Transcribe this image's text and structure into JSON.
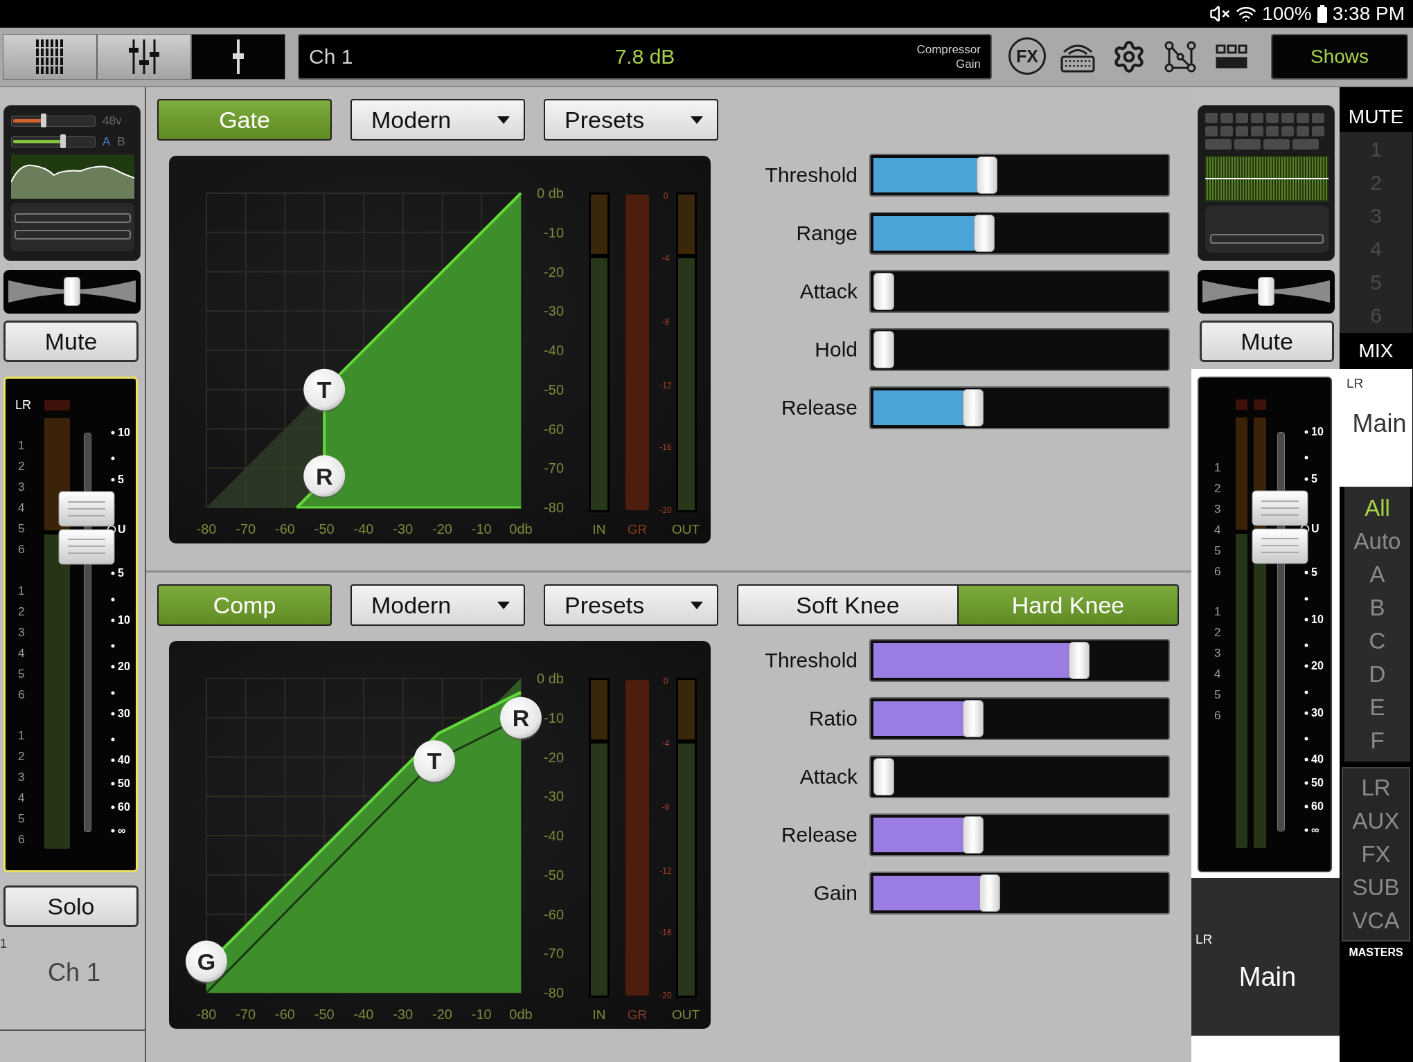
{
  "status_bar": {
    "battery": "100%",
    "time": "3:38 PM"
  },
  "toolbar": {
    "view_tabs": [
      {
        "kind": "bank",
        "selected": false
      },
      {
        "kind": "mixer",
        "selected": false
      },
      {
        "kind": "fader",
        "selected": true
      }
    ],
    "channel_display": {
      "channel": "Ch 1",
      "value": "7.8 dB",
      "parameter": [
        "Compressor",
        "Gain"
      ]
    },
    "tools": [
      {
        "kind": "fx",
        "label": "FX"
      },
      {
        "kind": "keyboard"
      },
      {
        "kind": "settings"
      },
      {
        "kind": "routing"
      },
      {
        "kind": "layout"
      }
    ],
    "shows_button": "Shows"
  },
  "channel_strip": {
    "gain_sliders": [
      {
        "color": "#d2602e",
        "level": 0.38
      },
      {
        "color": "#86c23c",
        "level": 0.62
      }
    ],
    "phantom": "48v",
    "inputs": [
      {
        "label": "A",
        "selected": true
      },
      {
        "label": "B",
        "selected": false
      }
    ],
    "pan": {
      "level": 0.5
    },
    "mute": {
      "label": "Mute",
      "on": false
    },
    "selected": true,
    "kind": "mono",
    "bus": "LR",
    "meter_groups": [
      [
        "1",
        "2",
        "3",
        "4",
        "5",
        "6"
      ],
      [
        "1",
        "2",
        "3",
        "4",
        "5",
        "6"
      ],
      [
        "1",
        "2",
        "3",
        "4",
        "5",
        "6"
      ]
    ],
    "scale": [
      {
        "label": "10",
        "kind": "tick"
      },
      {
        "label": "5",
        "kind": "tick"
      },
      {
        "label": "U",
        "kind": "unity"
      },
      {
        "label": "5",
        "kind": "tick"
      },
      {
        "label": "10",
        "kind": "tick"
      },
      {
        "label": "20",
        "kind": "tick"
      },
      {
        "label": "30",
        "kind": "tick"
      },
      {
        "label": "40",
        "kind": "tick"
      },
      {
        "label": "50",
        "kind": "tick"
      },
      {
        "label": "60",
        "kind": "tick"
      },
      {
        "label": "∞",
        "kind": "tick"
      }
    ],
    "fader": {
      "level": 0.76
    },
    "solo": {
      "label": "Solo",
      "on": false
    },
    "number": "1",
    "name": "Ch 1"
  },
  "gate": {
    "kind": "gate",
    "enabled": {
      "label": "Gate",
      "on": true
    },
    "mode": "Modern",
    "presets": "Presets",
    "graph": {
      "y_ticks": [
        "0 db",
        "-10",
        "-20",
        "-30",
        "-40",
        "-50",
        "-60",
        "-70",
        "-80"
      ],
      "x_ticks": [
        "-80",
        "-70",
        "-60",
        "-50",
        "-40",
        "-30",
        "-20",
        "-10",
        "0db"
      ],
      "meters": [
        {
          "label": "IN",
          "kind": "level"
        },
        {
          "label": "GR",
          "kind": "reduction"
        },
        {
          "label": "OUT",
          "kind": "level"
        }
      ],
      "gr_ticks": [
        "0",
        "-4",
        "-8",
        "-12",
        "-16",
        "-20"
      ],
      "handles": [
        "T",
        "R"
      ]
    },
    "params": [
      {
        "label": "Threshold",
        "level": 0.38
      },
      {
        "label": "Range",
        "level": 0.37
      },
      {
        "label": "Attack",
        "level": 0
      },
      {
        "label": "Hold",
        "level": 0
      },
      {
        "label": "Release",
        "level": 0.33
      }
    ]
  },
  "compressor": {
    "kind": "compressor",
    "enabled": {
      "label": "Comp",
      "on": true
    },
    "mode": "Modern",
    "presets": "Presets",
    "knee": [
      {
        "label": "Soft Knee",
        "selected": false
      },
      {
        "label": "Hard Knee",
        "selected": true
      }
    ],
    "graph": {
      "y_ticks": [
        "0 db",
        "-10",
        "-20",
        "-30",
        "-40",
        "-50",
        "-60",
        "-70",
        "-80"
      ],
      "x_ticks": [
        "-80",
        "-70",
        "-60",
        "-50",
        "-40",
        "-30",
        "-20",
        "-10",
        "0db"
      ],
      "meters": [
        {
          "label": "IN",
          "kind": "level"
        },
        {
          "label": "GR",
          "kind": "reduction"
        },
        {
          "label": "OUT",
          "kind": "level"
        }
      ],
      "gr_ticks": [
        "0",
        "-4",
        "-8",
        "-12",
        "-16",
        "-20"
      ],
      "handles": [
        "G",
        "T",
        "R"
      ]
    },
    "params": [
      {
        "label": "Threshold",
        "level": 0.72
      },
      {
        "label": "Ratio",
        "level": 0.33
      },
      {
        "label": "Attack",
        "level": 0
      },
      {
        "label": "Release",
        "level": 0.33
      },
      {
        "label": "Gain",
        "level": 0.39
      }
    ]
  },
  "master_strip": {
    "pan": {
      "level": 0.5
    },
    "mute": {
      "label": "Mute",
      "on": false
    },
    "selected": false,
    "kind": "stereo",
    "meter_groups": [
      [
        "1",
        "2",
        "3",
        "4",
        "5",
        "6"
      ],
      [
        "1",
        "2",
        "3",
        "4",
        "5",
        "6"
      ]
    ],
    "scale": [
      {
        "label": "10",
        "kind": "tick"
      },
      {
        "label": "5",
        "kind": "tick"
      },
      {
        "label": "U",
        "kind": "unity"
      },
      {
        "label": "5",
        "kind": "tick"
      },
      {
        "label": "10",
        "kind": "tick"
      },
      {
        "label": "20",
        "kind": "tick"
      },
      {
        "label": "30",
        "kind": "tick"
      },
      {
        "label": "40",
        "kind": "tick"
      },
      {
        "label": "50",
        "kind": "tick"
      },
      {
        "label": "60",
        "kind": "tick"
      },
      {
        "label": "∞",
        "kind": "tick"
      }
    ],
    "fader": {
      "level": 0.76
    },
    "bus": "LR",
    "name": "Main"
  },
  "nav": {
    "mute_header": "MUTE",
    "mute_groups": [
      "1",
      "2",
      "3",
      "4",
      "5",
      "6"
    ],
    "mix_header": "MIX",
    "current": {
      "bus": "LR",
      "name": "Main"
    },
    "filters": [
      {
        "label": "All",
        "selected": true
      },
      {
        "label": "Auto",
        "selected": false
      },
      {
        "label": "A",
        "selected": false
      },
      {
        "label": "B",
        "selected": false
      },
      {
        "label": "C",
        "selected": false
      },
      {
        "label": "D",
        "selected": false
      },
      {
        "label": "E",
        "selected": false
      },
      {
        "label": "F",
        "selected": false
      }
    ],
    "masters": [
      {
        "label": "LR",
        "selected": false
      },
      {
        "label": "AUX",
        "selected": false
      },
      {
        "label": "FX",
        "selected": false
      },
      {
        "label": "SUB",
        "selected": false
      },
      {
        "label": "VCA",
        "selected": false
      }
    ],
    "masters_header": "MASTERS"
  }
}
